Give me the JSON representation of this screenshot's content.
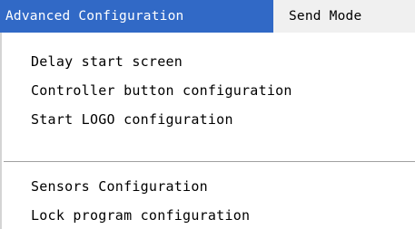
{
  "menubar": {
    "menus": [
      {
        "label": "Advanced Configuration",
        "active": true
      },
      {
        "label": "Send Mode",
        "active": false
      }
    ]
  },
  "dropdown": {
    "group_1": [
      {
        "label": "Delay start screen"
      },
      {
        "label": "Controller button configuration"
      },
      {
        "label": "Start LOGO configuration"
      }
    ],
    "group_2": [
      {
        "label": "Sensors Configuration"
      },
      {
        "label": "Lock program configuration"
      }
    ]
  },
  "colors": {
    "active_menu_bg": "#3169c6",
    "active_menu_text": "#ffffff",
    "menubar_bg": "#f0f0f0",
    "dropdown_bg": "#ffffff",
    "separator": "#a0a0a0"
  }
}
